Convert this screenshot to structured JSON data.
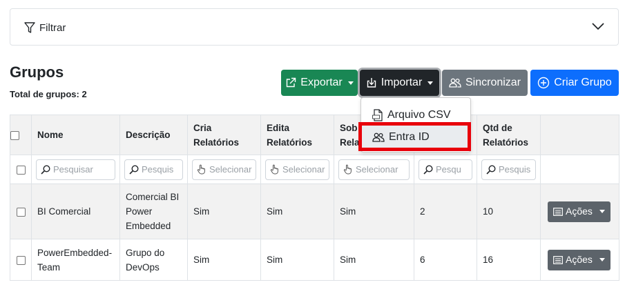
{
  "filter": {
    "label": "Filtrar"
  },
  "page": {
    "title": "Grupos",
    "total": "Total de grupos: 2"
  },
  "toolbar": {
    "export_label": "Exportar",
    "import_label": "Importar",
    "sync_label": "Sincronizar",
    "create_label": "Criar Grupo"
  },
  "import_menu": {
    "items": [
      "Arquivo CSV",
      "Entra ID"
    ],
    "highlighted": "Entra ID"
  },
  "table": {
    "headers": {
      "nome": "Nome",
      "descricao": "Descrição",
      "cria": [
        "Cria",
        "Relatórios"
      ],
      "edita": [
        "Edita",
        "Relatórios"
      ],
      "sob": [
        "Sob",
        "Rela"
      ],
      "qtd": [
        "Qtd de",
        "Relatórios"
      ]
    },
    "search": {
      "pesquisar": "Pesquisar",
      "pesquis": "Pesquis",
      "selecionar": "Selecionar",
      "pesqu": "Pesqu",
      "pesquis2": "Pesquis"
    },
    "rows": [
      {
        "nome": "BI Comercial",
        "descricao": [
          "Comercial BI",
          "Power",
          "Embedded"
        ],
        "cria": "Sim",
        "edita": "Sim",
        "sob": "Sim",
        "col6": "2",
        "qtd": "10",
        "acoes": "Ações"
      },
      {
        "nome": [
          "PowerEmbedded-",
          "Team"
        ],
        "descricao": [
          "Grupo do",
          "DevOps"
        ],
        "cria": "Sim",
        "edita": "Sim",
        "sob": "Sim",
        "col6": "6",
        "qtd": "16",
        "acoes": "Ações"
      }
    ]
  },
  "colors": {
    "export": "#198754",
    "import": "#212529",
    "sync": "#6c757d",
    "create": "#0d6efd",
    "highlight": "#e8000b"
  }
}
